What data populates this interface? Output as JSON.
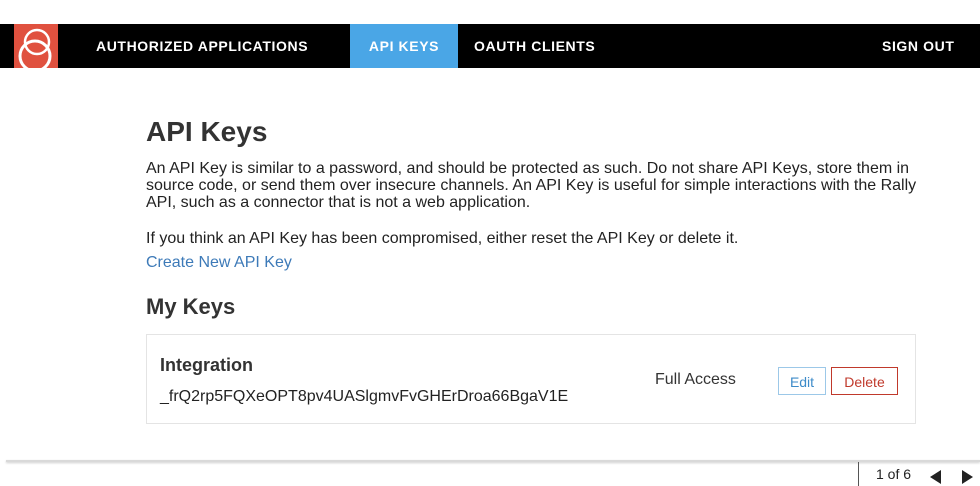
{
  "nav": {
    "items": [
      {
        "label": "AUTHORIZED APPLICATIONS"
      },
      {
        "label": "API KEYS",
        "active": true
      },
      {
        "label": "OAUTH CLIENTS"
      }
    ],
    "sign_out": "SIGN OUT",
    "logo_icon": "rally-logo-icon"
  },
  "page": {
    "title": "API Keys",
    "description": "An API Key is similar to a password, and should be protected as such. Do not share API Keys, store them in source code, or send them over insecure channels. An API Key is useful for simple interactions with the Rally API, such as a connector that is not a web application.",
    "compromise_note": "If you think an API Key has been compromised, either reset the API Key or delete it.",
    "create_link": "Create New API Key",
    "my_keys_heading": "My Keys"
  },
  "keys": [
    {
      "name": "Integration",
      "value": "_frQ2rp5FQXeOPT8pv4UASlgmvFvGHErDroa66BgaV1E",
      "access": "Full Access",
      "edit_label": "Edit",
      "delete_label": "Delete"
    }
  ],
  "pager": {
    "text": "1 of 6",
    "prev_icon": "triangle-left-icon",
    "next_icon": "triangle-right-icon"
  },
  "colors": {
    "nav_bg": "#000000",
    "nav_active": "#4aa6e6",
    "logo_bg": "#e0513f",
    "link": "#3d7ab8",
    "delete_red": "#c0392b"
  }
}
